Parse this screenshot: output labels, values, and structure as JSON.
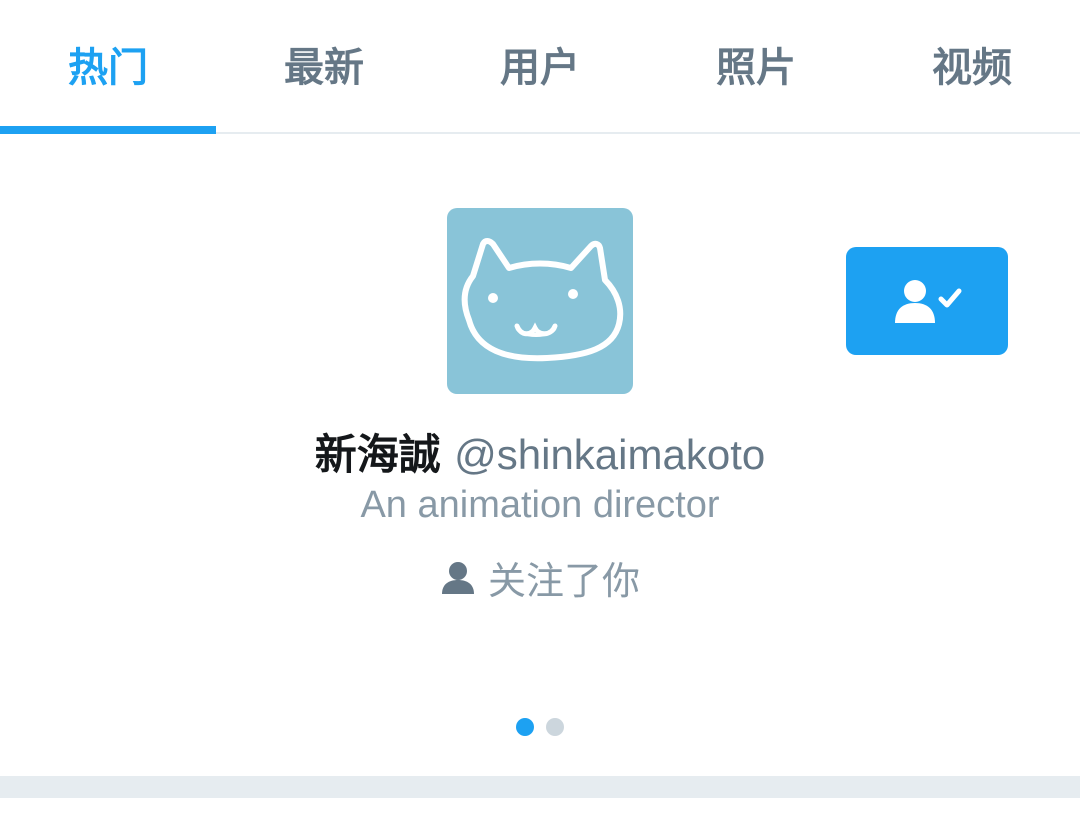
{
  "tabs": [
    {
      "label": "热门",
      "active": true
    },
    {
      "label": "最新",
      "active": false
    },
    {
      "label": "用户",
      "active": false
    },
    {
      "label": "照片",
      "active": false
    },
    {
      "label": "视频",
      "active": false
    }
  ],
  "user_card": {
    "display_name": "新海誠",
    "handle": "@shinkaimakoto",
    "bio": "An animation director",
    "follows_you": "关注了你",
    "avatar_icon": "cat-face-avatar",
    "follow_button_icon": "user-following-icon"
  },
  "pager": {
    "total": 2,
    "active_index": 0
  },
  "colors": {
    "accent": "#1da1f2",
    "avatar_bg": "#89c4d8",
    "text_primary": "#14171a",
    "text_secondary": "#657786"
  }
}
